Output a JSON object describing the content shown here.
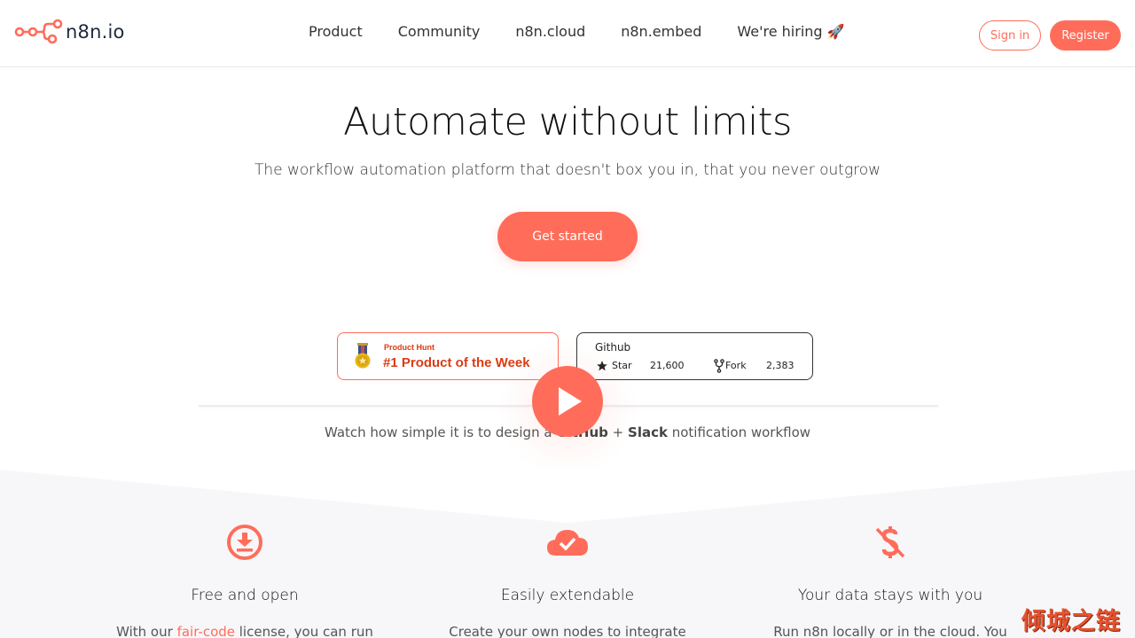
{
  "header": {
    "logo_text": "n8n.io",
    "nav": [
      "Product",
      "Community",
      "n8n.cloud",
      "n8n.embed",
      "We're hiring 🚀"
    ],
    "sign_in": "Sign in",
    "register": "Register"
  },
  "hero": {
    "title": "Automate without limits",
    "subtitle": "The workflow automation platform that doesn't box you in, that you never outgrow",
    "cta": "Get started"
  },
  "badges": {
    "product_hunt": {
      "label": "Product Hunt",
      "title": "#1 Product of the Week",
      "icon": "medal-icon"
    },
    "github": {
      "title": "Github",
      "star_label": "Star",
      "star_count": "21,600",
      "fork_label": "Fork",
      "fork_count": "2,383"
    }
  },
  "video": {
    "caption_pre": "Watch how simple it is to design a ",
    "caption_github": "GitHub",
    "caption_plus": " + ",
    "caption_slack": "Slack",
    "caption_post": " notification workflow"
  },
  "features": [
    {
      "icon": "download-icon",
      "title": "Free and open",
      "text_pre": "With our ",
      "link": "fair-code",
      "text_post": " license, you can run"
    },
    {
      "icon": "cloud-check-icon",
      "title": "Easily extendable",
      "text_pre": "Create your own nodes to integrate",
      "link": "",
      "text_post": ""
    },
    {
      "icon": "no-dollar-icon",
      "title": "Your data stays with you",
      "text_pre": "Run n8n locally or in the cloud. You",
      "link": "",
      "text_post": ""
    }
  ],
  "watermark": "倾城之链",
  "colors": {
    "accent": "#ff6d5a",
    "ph_red": "#da3c14",
    "text_dark": "#111111"
  }
}
